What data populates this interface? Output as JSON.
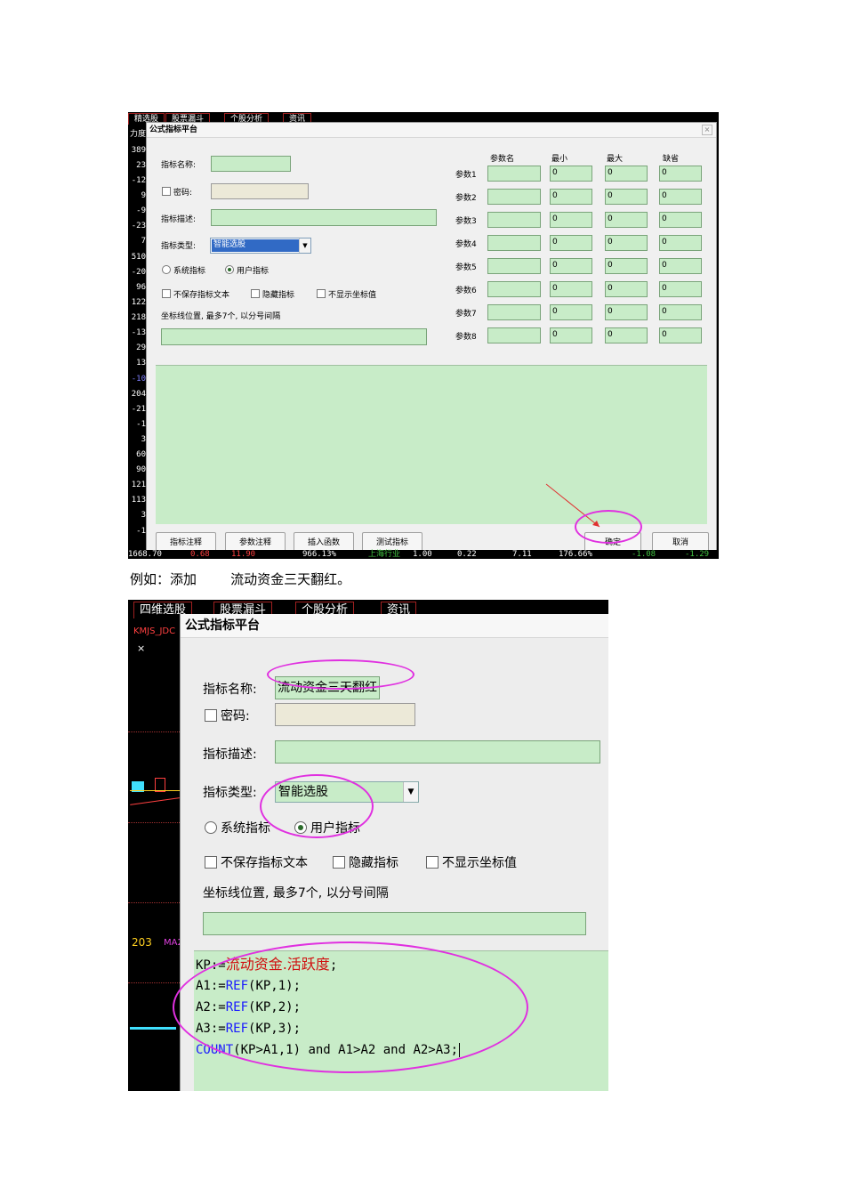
{
  "shot1": {
    "tabs": [
      "精选股",
      "股票漏斗",
      "个股分析",
      "资讯"
    ],
    "left_numbers": [
      "力度",
      "389",
      "23",
      "-12",
      "9",
      "-9",
      "-23",
      "7",
      "510",
      "-20",
      "96",
      "122",
      "218",
      "-13",
      "29",
      "13",
      "-10",
      "204",
      "-21",
      "-1",
      "3",
      "60",
      "90",
      "121",
      "113",
      "3",
      "-1"
    ],
    "bottom_strip": [
      "1668.70",
      "0.68",
      "11.90",
      "966.13%",
      "上海行业",
      "1.00",
      "0.22",
      "7.11",
      "176.66%",
      "-1.08",
      "-1.29"
    ],
    "window_title": "公式指标平台",
    "close_icon": "×",
    "labels": {
      "name": "指标名称:",
      "password": "密码:",
      "desc": "指标描述:",
      "type": "指标类型:",
      "system": "系统指标",
      "user": "用户指标",
      "no_save": "不保存指标文本",
      "hide": "隐藏指标",
      "no_coord": "不显示坐标值",
      "coord_pos": "坐标线位置, 最多7个, 以分号间隔"
    },
    "type_value": "智能选股",
    "param_headers": [
      "参数名",
      "最小",
      "最大",
      "缺省"
    ],
    "params": [
      {
        "label": "参数1",
        "min": "0",
        "max": "0",
        "def": "0"
      },
      {
        "label": "参数2",
        "min": "0",
        "max": "0",
        "def": "0"
      },
      {
        "label": "参数3",
        "min": "0",
        "max": "0",
        "def": "0"
      },
      {
        "label": "参数4",
        "min": "0",
        "max": "0",
        "def": "0"
      },
      {
        "label": "参数5",
        "min": "0",
        "max": "0",
        "def": "0"
      },
      {
        "label": "参数6",
        "min": "0",
        "max": "0",
        "def": "0"
      },
      {
        "label": "参数7",
        "min": "0",
        "max": "0",
        "def": "0"
      },
      {
        "label": "参数8",
        "min": "0",
        "max": "0",
        "def": "0"
      }
    ],
    "buttons": {
      "annotate": "指标注释",
      "param_note": "参数注释",
      "insert_func": "插入函数",
      "test": "测试指标",
      "ok": "确定",
      "cancel": "取消"
    },
    "colors": {
      "field": "#c8ecc8",
      "annotation": "#e030e0",
      "arrow": "#e03030"
    }
  },
  "caption": "例如：添加        流动资金三天翻红。",
  "shot2": {
    "tabs": [
      "四维选股",
      "股票漏斗",
      "个股分析",
      "资讯"
    ],
    "left_labels": [
      "KMJS_JDC",
      "×",
      "203",
      "MA2"
    ],
    "window_title": "公式指标平台",
    "labels": {
      "name": "指标名称:",
      "password": "密码:",
      "desc": "指标描述:",
      "type": "指标类型:",
      "system": "系统指标",
      "user": "用户指标",
      "no_save": "不保存指标文本",
      "hide": "隐藏指标",
      "no_coord": "不显示坐标值",
      "coord_pos": "坐标线位置, 最多7个, 以分号间隔"
    },
    "name_value": "流动资金三天翻红",
    "type_value": "智能选股",
    "code": {
      "l1_a": "KP:=",
      "l1_b": "流动资金.活跃度",
      "l1_c": ";",
      "l2_a": "A1:=",
      "l2_b": "REF",
      "l2_c": "(KP,1);",
      "l3_a": "A2:=",
      "l3_b": "REF",
      "l3_c": "(KP,2);",
      "l4_a": "A3:=",
      "l4_b": "REF",
      "l4_c": "(KP,3);",
      "l5_a": "COUNT",
      "l5_b": "(KP>A1,1) and A1>A2 and A2>A3;"
    }
  }
}
